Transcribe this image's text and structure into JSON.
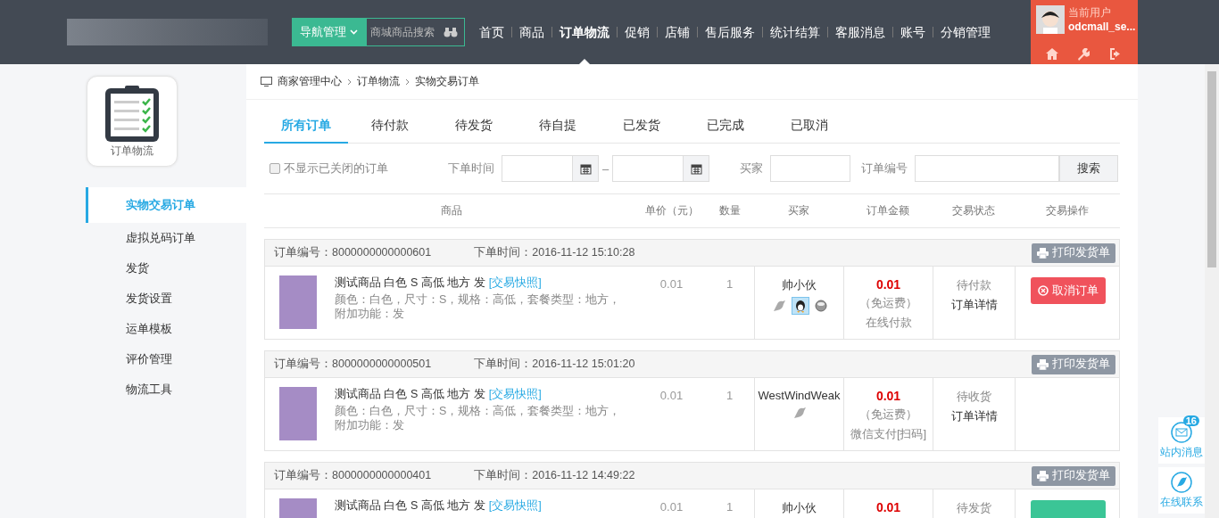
{
  "header": {
    "nav_button": "导航管理",
    "search": {
      "placeholder": "商城商品搜索"
    },
    "nav": [
      {
        "label": "首页",
        "selected": false
      },
      {
        "label": "商品",
        "selected": false
      },
      {
        "label": "订单物流",
        "selected": true
      },
      {
        "label": "促销",
        "selected": false
      },
      {
        "label": "店铺",
        "selected": false
      },
      {
        "label": "售后服务",
        "selected": false
      },
      {
        "label": "统计结算",
        "selected": false
      },
      {
        "label": "客服消息",
        "selected": false
      },
      {
        "label": "账号",
        "selected": false
      },
      {
        "label": "分销管理",
        "selected": false
      }
    ],
    "user": {
      "label": "当前用户",
      "name": "odcmall_se..."
    }
  },
  "sidebar": {
    "title": "订单物流",
    "items": [
      {
        "label": "实物交易订单",
        "selected": true
      },
      {
        "label": "虚拟兑码订单",
        "selected": false
      },
      {
        "label": "发货",
        "selected": false
      },
      {
        "label": "发货设置",
        "selected": false
      },
      {
        "label": "运单模板",
        "selected": false
      },
      {
        "label": "评价管理",
        "selected": false
      },
      {
        "label": "物流工具",
        "selected": false
      }
    ]
  },
  "breadcrumb": [
    "商家管理中心",
    "订单物流",
    "实物交易订单"
  ],
  "tabs": [
    {
      "label": "所有订单",
      "selected": true
    },
    {
      "label": "待付款",
      "selected": false
    },
    {
      "label": "待发货",
      "selected": false
    },
    {
      "label": "待自提",
      "selected": false
    },
    {
      "label": "已发货",
      "selected": false
    },
    {
      "label": "已完成",
      "selected": false
    },
    {
      "label": "已取消",
      "selected": false
    }
  ],
  "filters": {
    "hide_closed": {
      "label": "不显示已关闭的订单",
      "checked": false
    },
    "time_label": "下单时间",
    "separator": "–",
    "buyer_label": "买家",
    "order_no_label": "订单编号",
    "search_button": "搜索"
  },
  "columns": [
    "商品",
    "单价（元）",
    "数量",
    "买家",
    "订单金额",
    "交易状态",
    "交易操作"
  ],
  "orders": [
    {
      "order_no": "订单编号：8000000000000601",
      "time": "下单时间：2016-11-12 15:10:28",
      "print_button": "打印发货单",
      "title": "测试商品 白色 S 高低 地方 发",
      "snapshot": "[交易快照]",
      "spec": "颜色：白色，尺寸：S，规格：高低，套餐类型：地方，附加功能：发",
      "price": "0.01",
      "qty": "1",
      "buyer": "帅小伙",
      "buyer_icons": [
        {
          "kind": "chat"
        },
        {
          "kind": "qq"
        },
        {
          "kind": "ww"
        }
      ],
      "amount": "0.01",
      "freight": "（免运费）",
      "payment": "在线付款",
      "status": "待付款",
      "detail": "订单详情",
      "action": {
        "kind": "cancel",
        "label": "取消订单"
      }
    },
    {
      "order_no": "订单编号：8000000000000501",
      "time": "下单时间：2016-11-12 15:01:20",
      "print_button": "打印发货单",
      "title": "测试商品 白色 S 高低 地方 发",
      "snapshot": "[交易快照]",
      "spec": "颜色：白色，尺寸：S，规格：高低，套餐类型：地方，附加功能：发",
      "price": "0.01",
      "qty": "1",
      "buyer": "WestWindWeak",
      "buyer_icons": [
        {
          "kind": "chat"
        }
      ],
      "amount": "0.01",
      "freight": "（免运费）",
      "payment": "微信支付[扫码]",
      "status": "待收货",
      "detail": "订单详情"
    },
    {
      "order_no": "订单编号：8000000000000401",
      "time": "下单时间：2016-11-12 14:49:22",
      "print_button": "打印发货单",
      "title": "测试商品 白色 S 高低 地方 发",
      "snapshot": "[交易快照]",
      "price": "0.01",
      "qty": "1",
      "buyer": "帅小伙",
      "amount": "0.01",
      "status": "待发货",
      "action": {
        "kind": "ship"
      }
    }
  ],
  "float_buttons": [
    {
      "kind": "message",
      "label": "站内消息",
      "badge": "16"
    },
    {
      "kind": "contact",
      "label": "在线联系"
    }
  ]
}
